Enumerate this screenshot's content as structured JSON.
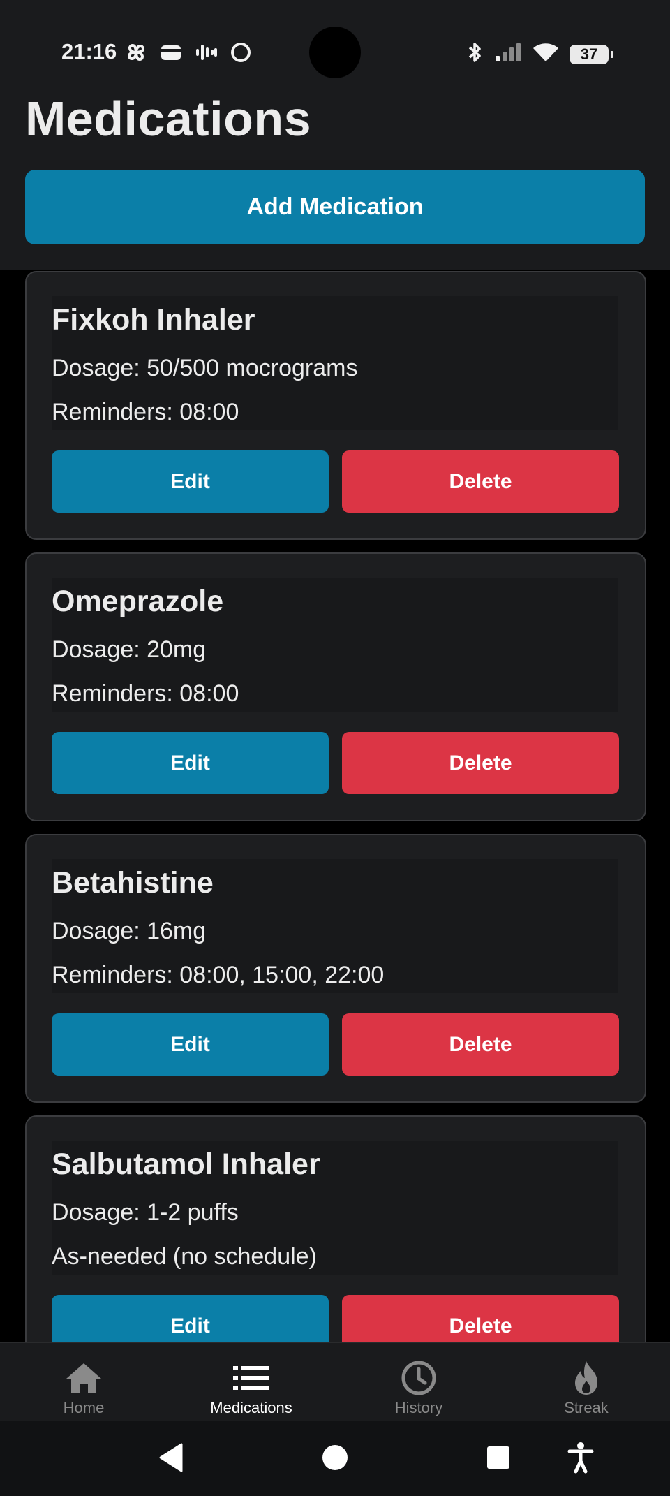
{
  "status_bar": {
    "time": "21:16",
    "left_icons": [
      "pinwheel-icon",
      "wallet-icon",
      "waveform-icon",
      "circle-icon"
    ],
    "right_icons": [
      "bluetooth-icon",
      "signal-icon",
      "wifi-icon"
    ],
    "battery": "37"
  },
  "header": {
    "title": "Medications",
    "add_button": "Add Medication"
  },
  "medications": [
    {
      "name": "Fixkoh Inhaler",
      "dosage": "Dosage: 50/500 mocrograms",
      "schedule": "Reminders: 08:00",
      "edit_label": "Edit",
      "delete_label": "Delete"
    },
    {
      "name": "Omeprazole",
      "dosage": "Dosage: 20mg",
      "schedule": "Reminders: 08:00",
      "edit_label": "Edit",
      "delete_label": "Delete"
    },
    {
      "name": "Betahistine",
      "dosage": "Dosage: 16mg",
      "schedule": "Reminders: 08:00, 15:00, 22:00",
      "edit_label": "Edit",
      "delete_label": "Delete"
    },
    {
      "name": "Salbutamol Inhaler",
      "dosage": "Dosage: 1-2 puffs",
      "schedule": "As-needed (no schedule)",
      "edit_label": "Edit",
      "delete_label": "Delete"
    }
  ],
  "bottom_nav": {
    "items": [
      {
        "label": "Home",
        "icon": "home-icon",
        "active": false
      },
      {
        "label": "Medications",
        "icon": "list-icon",
        "active": true
      },
      {
        "label": "History",
        "icon": "clock-icon",
        "active": false
      },
      {
        "label": "Streak",
        "icon": "flame-icon",
        "active": false
      }
    ]
  },
  "system_nav": {
    "icons": [
      "back-icon",
      "home-circle-icon",
      "recents-icon",
      "accessibility-icon"
    ]
  },
  "colors": {
    "accent": "#0b7fa8",
    "danger": "#dc3545",
    "header_bg": "#1a1b1d",
    "card_bg": "#1d1e20"
  }
}
